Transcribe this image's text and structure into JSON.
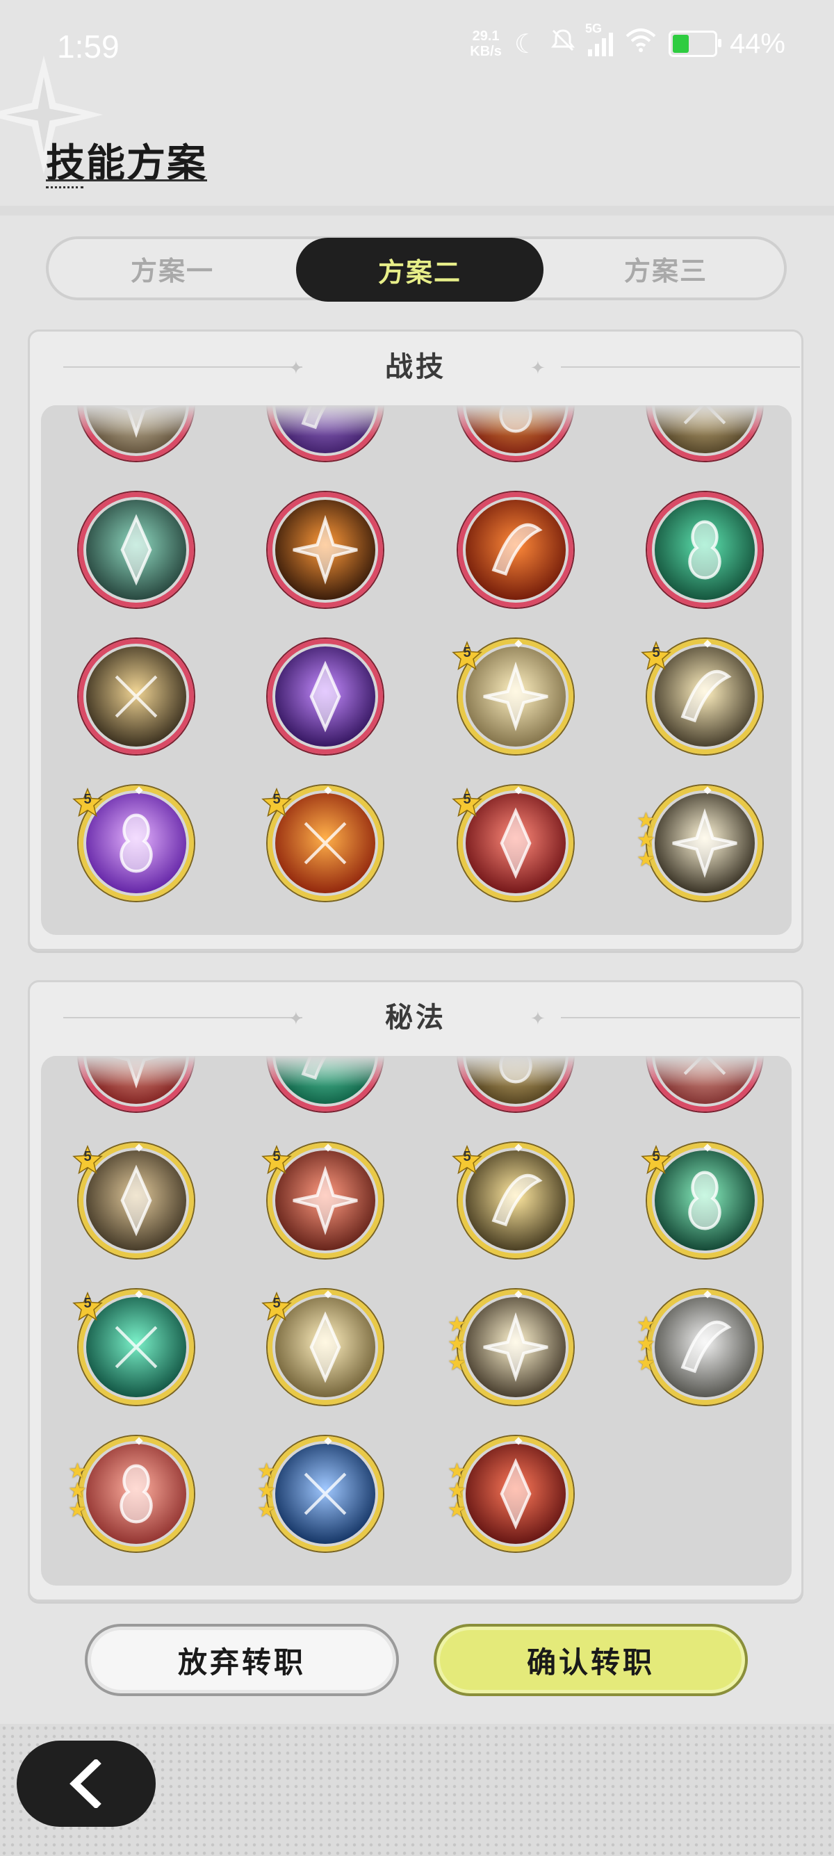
{
  "status_bar": {
    "time": "1:59",
    "net_speed_value": "29.1",
    "net_speed_unit": "KB/s",
    "signal": "5G",
    "battery": "44%",
    "battery_level": 0.44,
    "icons": [
      "moon-icon",
      "mute-icon",
      "signal-icon",
      "wifi-icon",
      "battery-icon"
    ]
  },
  "header": {
    "title": "技能方案"
  },
  "tabs": [
    {
      "label": "方案一",
      "active": false
    },
    {
      "label": "方案二",
      "active": true
    },
    {
      "label": "方案三",
      "active": false
    }
  ],
  "combat": {
    "title": "战技",
    "skills": [
      {
        "name": "shattered-rune-skill-icon",
        "frame": "red"
      },
      {
        "name": "shadow-wing-skill-icon",
        "frame": "red"
      },
      {
        "name": "flame-slash-skill-icon",
        "frame": "red"
      },
      {
        "name": "golden-burst-skill-icon",
        "frame": "red"
      },
      {
        "name": "web-trap-skill-icon",
        "frame": "red"
      },
      {
        "name": "fire-swipe-skill-icon",
        "frame": "red"
      },
      {
        "name": "burning-figure-skill-icon",
        "frame": "red"
      },
      {
        "name": "wind-arrows-skill-icon",
        "frame": "red"
      },
      {
        "name": "golden-crescent-skill-icon",
        "frame": "red"
      },
      {
        "name": "ghost-face-skill-icon",
        "frame": "red"
      },
      {
        "name": "piercing-blade-skill-icon",
        "frame": "gold",
        "level": "5"
      },
      {
        "name": "sweeping-slash-skill-icon",
        "frame": "gold",
        "level": "5"
      },
      {
        "name": "arcane-star-skill-icon",
        "frame": "gold",
        "level": "5"
      },
      {
        "name": "fire-sigil-skill-icon",
        "frame": "gold",
        "level": "5"
      },
      {
        "name": "rage-strike-skill-icon",
        "frame": "gold",
        "level": "5"
      },
      {
        "name": "radiant-star-skill-icon",
        "frame": "gold",
        "stars": 3
      }
    ]
  },
  "arcana": {
    "title": "秘法",
    "skills": [
      {
        "name": "crimson-flame-arcana-icon",
        "frame": "red"
      },
      {
        "name": "jade-rune-arcana-icon",
        "frame": "red"
      },
      {
        "name": "golden-sprite-arcana-icon",
        "frame": "red"
      },
      {
        "name": "rose-bloom-arcana-icon",
        "frame": "red"
      },
      {
        "name": "beast-claw-arcana-icon",
        "frame": "gold",
        "level": "5"
      },
      {
        "name": "ember-stone-arcana-icon",
        "frame": "gold",
        "level": "5"
      },
      {
        "name": "vortex-arcana-icon",
        "frame": "gold",
        "level": "5"
      },
      {
        "name": "leaf-arrows-arcana-icon",
        "frame": "gold",
        "level": "5"
      },
      {
        "name": "emerald-crown-arcana-icon",
        "frame": "gold",
        "level": "5"
      },
      {
        "name": "healing-figure-arcana-icon",
        "frame": "gold",
        "level": "5"
      },
      {
        "name": "all-seeing-eye-arcana-icon",
        "frame": "gold",
        "stars": 3
      },
      {
        "name": "crystal-shard-arcana-icon",
        "frame": "gold",
        "stars": 3
      },
      {
        "name": "cross-sword-arcana-icon",
        "frame": "gold",
        "stars": 3
      },
      {
        "name": "frost-crystal-arcana-icon",
        "frame": "gold",
        "stars": 3
      },
      {
        "name": "blazing-fist-arcana-icon",
        "frame": "gold",
        "stars": 3
      }
    ]
  },
  "buttons": {
    "abandon": "放弃转职",
    "confirm": "确认转职"
  },
  "colors": {
    "active_tab_bg": "#1f1f1f",
    "active_tab_text": "#e7ee89",
    "confirm_bg": "#e4ea7a",
    "red_frame": "#d94b66",
    "gold_frame": "#e9c948"
  }
}
